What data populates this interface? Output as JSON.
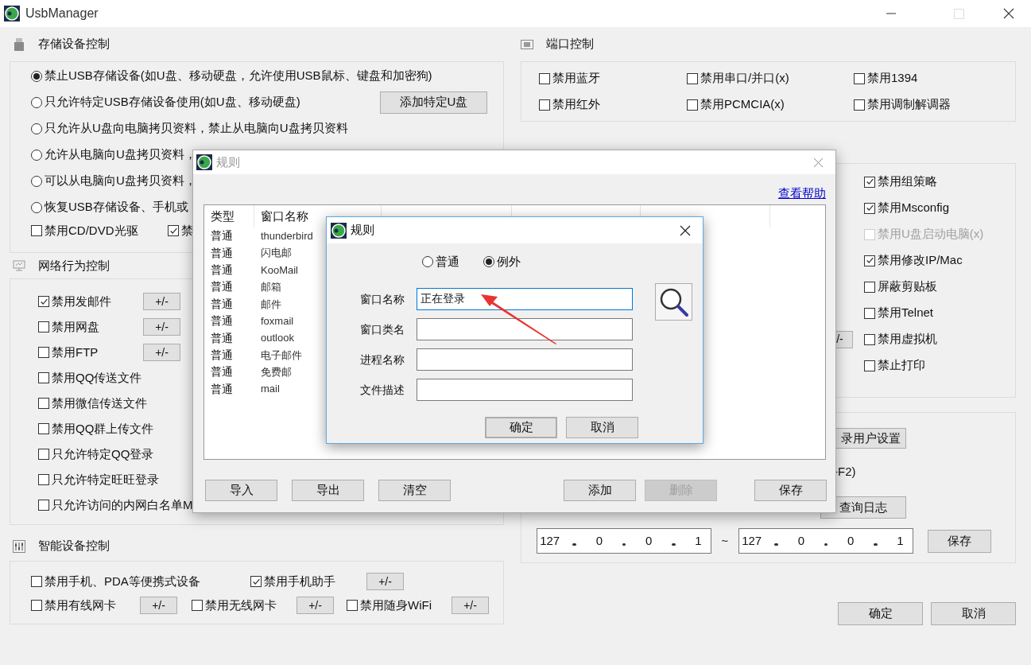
{
  "window": {
    "title": "UsbManager"
  },
  "storage": {
    "title": "存储设备控制",
    "options": [
      {
        "label": "禁止USB存储设备(如U盘、移动硬盘，允许使用USB鼠标、键盘和加密狗)",
        "selected": true
      },
      {
        "label": "只允许特定USB存储设备使用(如U盘、移动硬盘)",
        "selected": false,
        "button": "添加特定U盘"
      },
      {
        "label": "只允许从U盘向电脑拷贝资料，禁止从电脑向U盘拷贝资料",
        "selected": false
      },
      {
        "label": "允许从电脑向U盘拷贝资料，",
        "selected": false
      },
      {
        "label": "可以从电脑向U盘拷贝资料，",
        "selected": false
      },
      {
        "label": "恢复USB存储设备、手机或",
        "selected": false
      }
    ],
    "checkboxes": [
      {
        "label": "禁用CD/DVD光驱",
        "checked": false
      },
      {
        "label": "禁",
        "checked": true
      }
    ]
  },
  "network": {
    "title": "网络行为控制",
    "items": [
      {
        "label": "禁用发邮件",
        "checked": true,
        "button": "+/-"
      },
      {
        "label": "禁用网盘",
        "checked": false,
        "button": "+/-"
      },
      {
        "label": "禁用FTP",
        "checked": false,
        "button": "+/-"
      },
      {
        "label": "禁用QQ传送文件",
        "checked": false
      },
      {
        "label": "禁用微信传送文件",
        "checked": false
      },
      {
        "label": "禁用QQ群上传文件",
        "checked": false
      },
      {
        "label": "只允许特定QQ登录",
        "checked": false
      },
      {
        "label": "只允许特定旺旺登录",
        "checked": false
      },
      {
        "label": "只允许访问的内网白名单M",
        "checked": false
      }
    ]
  },
  "smart": {
    "title": "智能设备控制",
    "rows": [
      [
        {
          "label": "禁用手机、PDA等便携式设备",
          "checked": false
        },
        {
          "label": "禁用手机助手",
          "checked": true,
          "button": "+/-"
        }
      ],
      [
        {
          "label": "禁用有线网卡",
          "checked": false,
          "button": "+/-"
        },
        {
          "label": "禁用无线网卡",
          "checked": false,
          "button": "+/-"
        },
        {
          "label": "禁用随身WiFi",
          "checked": false,
          "button": "+/-"
        }
      ]
    ]
  },
  "ports": {
    "title": "端口控制",
    "items": [
      {
        "label": "禁用蓝牙",
        "checked": false
      },
      {
        "label": "禁用串口/并口(x)",
        "checked": false
      },
      {
        "label": "禁用1394",
        "checked": false
      },
      {
        "label": "禁用红外",
        "checked": false
      },
      {
        "label": "禁用PCMCIA(x)",
        "checked": false
      },
      {
        "label": "禁用调制解调器",
        "checked": false
      }
    ]
  },
  "os": {
    "items": [
      {
        "label": "禁用组策略",
        "checked": true,
        "disabled": false
      },
      {
        "label": "禁用Msconfig",
        "checked": true,
        "disabled": false
      },
      {
        "label": "禁用U盘启动电脑(x)",
        "checked": false,
        "disabled": true
      },
      {
        "label": "禁用修改IP/Mac",
        "checked": true,
        "disabled": false
      },
      {
        "label": "屏蔽剪贴板",
        "checked": false,
        "disabled": false
      },
      {
        "label": "禁用Telnet",
        "checked": false,
        "disabled": false
      },
      {
        "label": "禁用虚拟机",
        "checked": false,
        "disabled": false,
        "button": "/-"
      },
      {
        "label": "禁止打印",
        "checked": false,
        "disabled": false
      }
    ]
  },
  "login": {
    "user_settings_button": "录用户设置",
    "hotkey_text": "-F2)",
    "log_button": "查询日志"
  },
  "ip_range": {
    "from": [
      "127",
      "0",
      "0",
      "1"
    ],
    "to": [
      "127",
      "0",
      "0",
      "1"
    ],
    "separator": "~",
    "save_button": "保存"
  },
  "footer_buttons": [
    "确定",
    "取消"
  ],
  "rules_dialog": {
    "title": "规则",
    "help_link": "查看帮助",
    "columns": [
      "类型",
      "窗口名称"
    ],
    "rows": [
      {
        "type": "普通",
        "window_name": "thunderbird"
      },
      {
        "type": "普通",
        "window_name": "闪电邮"
      },
      {
        "type": "普通",
        "window_name": "KooMail"
      },
      {
        "type": "普通",
        "window_name": "邮箱"
      },
      {
        "type": "普通",
        "window_name": "邮件"
      },
      {
        "type": "普通",
        "window_name": "foxmail"
      },
      {
        "type": "普通",
        "window_name": "outlook"
      },
      {
        "type": "普通",
        "window_name": "电子邮件"
      },
      {
        "type": "普通",
        "window_name": "免费邮"
      },
      {
        "type": "普通",
        "window_name": "mail"
      }
    ],
    "buttons": [
      {
        "label": "导入",
        "disabled": false
      },
      {
        "label": "导出",
        "disabled": false
      },
      {
        "label": "清空",
        "disabled": false
      },
      {
        "label": "添加",
        "disabled": false
      },
      {
        "label": "删除",
        "disabled": true
      },
      {
        "label": "保存",
        "disabled": false
      }
    ]
  },
  "rule_editor": {
    "title": "规则",
    "modes": [
      {
        "label": "普通",
        "selected": false
      },
      {
        "label": "例外",
        "selected": true
      }
    ],
    "fields": [
      {
        "label": "窗口名称",
        "value": "正在登录",
        "focused": true
      },
      {
        "label": "窗口类名",
        "focused": false
      },
      {
        "label": "进程名称",
        "focused": false
      },
      {
        "label": "文件描述",
        "focused": false
      }
    ],
    "buttons": [
      {
        "label": "确定",
        "default": true
      },
      {
        "label": "取消",
        "default": false
      }
    ]
  }
}
